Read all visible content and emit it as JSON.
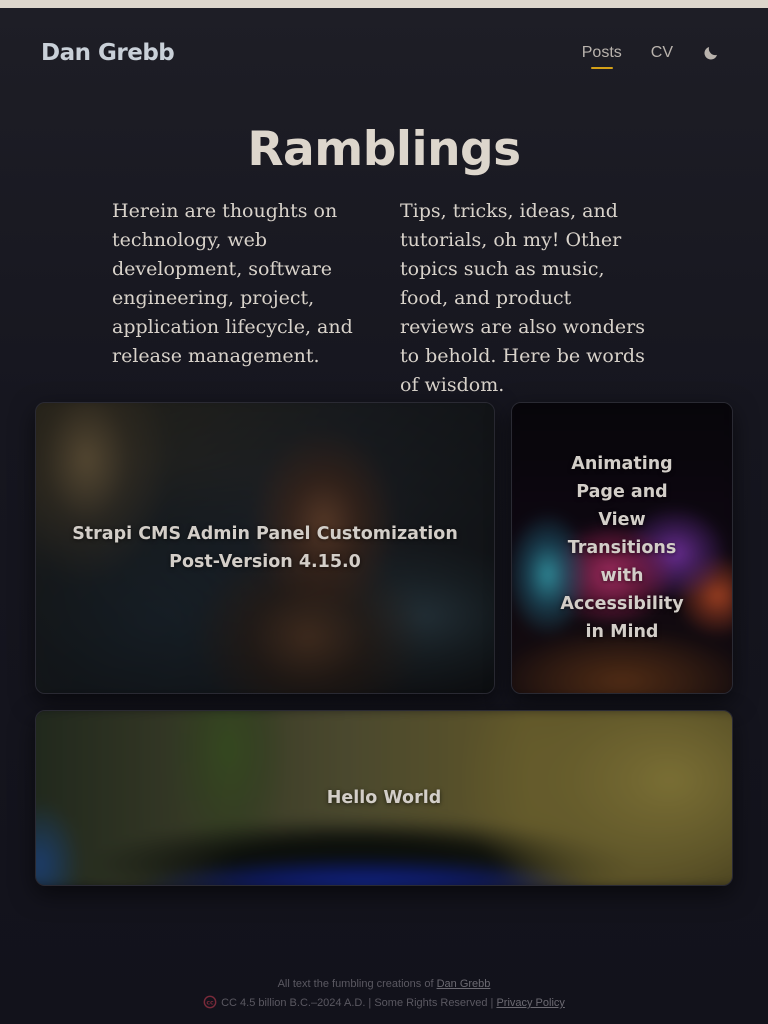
{
  "header": {
    "logo": "Dan Grebb",
    "nav": [
      {
        "label": "Posts",
        "active": true
      },
      {
        "label": "CV",
        "active": false
      }
    ],
    "theme_icon": "moon-icon"
  },
  "main": {
    "title": "Ramblings",
    "intro_left": "Herein are thoughts on technology, web development, software engineering, project, application lifecycle, and release management.",
    "intro_right": "Tips, tricks, ideas, and tutorials, oh my! Other topics such as music, food, and product reviews are also wonders to behold. Here be words of wisdom.",
    "posts": [
      {
        "title": "Strapi CMS Admin Panel Customization Post-Version 4.15.0"
      },
      {
        "title": "Animating Page and View Transitions with Accessibility in Mind"
      },
      {
        "title": "Hello World"
      }
    ]
  },
  "footer": {
    "line1_prefix": "All text the fumbling creations of",
    "author_link": "Dan Grebb",
    "line2_text": "CC 4.5 billion B.C.–2024 A.D. | Some Rights Reserved |",
    "privacy_link": "Privacy Policy",
    "license_icon": "creative-commons-icon"
  },
  "colors": {
    "accent": "#d4a017",
    "license_icon": "#7a2a3a"
  }
}
